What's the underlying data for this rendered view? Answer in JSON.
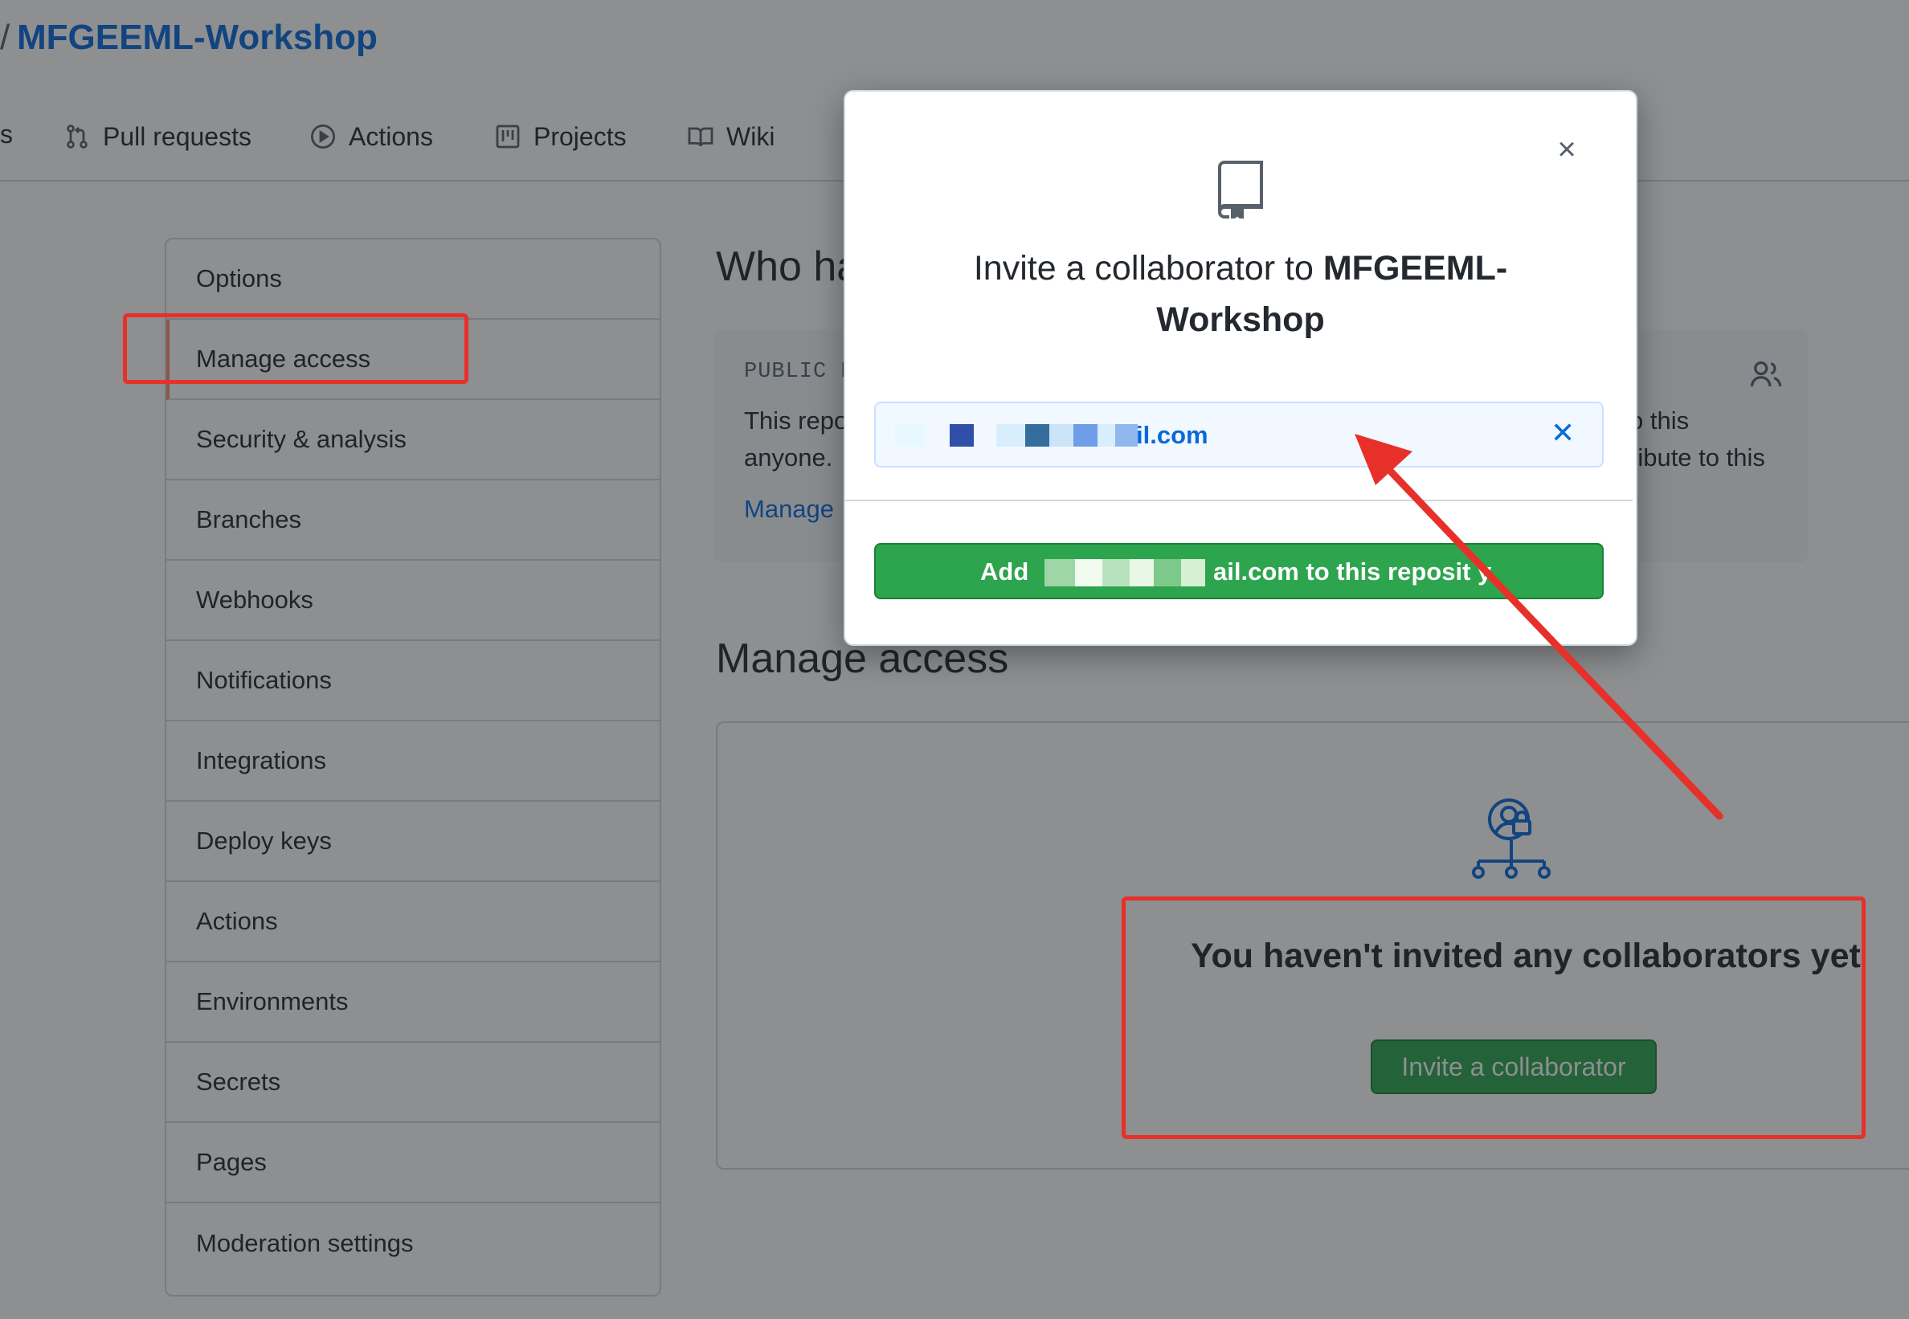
{
  "repo": {
    "slash": "/",
    "name": "MFGEEML-Workshop"
  },
  "tabs": [
    {
      "label": "s",
      "icon": "truncated"
    },
    {
      "label": "Pull requests",
      "icon": "pull-request-icon"
    },
    {
      "label": "Actions",
      "icon": "play-icon"
    },
    {
      "label": "Projects",
      "icon": "project-icon"
    },
    {
      "label": "Wiki",
      "icon": "book-icon"
    }
  ],
  "sidebar": {
    "items": [
      {
        "label": "Options"
      },
      {
        "label": "Manage access"
      },
      {
        "label": "Security & analysis"
      },
      {
        "label": "Branches"
      },
      {
        "label": "Webhooks"
      },
      {
        "label": "Notifications"
      },
      {
        "label": "Integrations"
      },
      {
        "label": "Deploy keys"
      },
      {
        "label": "Actions"
      },
      {
        "label": "Environments"
      },
      {
        "label": "Secrets"
      },
      {
        "label": "Pages"
      },
      {
        "label": "Moderation settings"
      }
    ]
  },
  "who": {
    "title": "Who ha",
    "public_label": "PUBLIC R",
    "text_line1": "This repo",
    "text_line2": "anyone.",
    "manage_link": "Manage",
    "right_line1": "o this",
    "right_line2": "ribute to this"
  },
  "manage_access": {
    "title": "Manage access",
    "empty_text": "You haven't invited any collaborators yet",
    "invite_button": "Invite a collaborator"
  },
  "modal": {
    "title_prefix": "Invite a collaborator to ",
    "title_repo_part1": "MFGEEML-",
    "title_repo_part2": "Workshop",
    "email_visible_suffix": "il.com",
    "add_prefix": "Add",
    "add_suffix": "ail.com to this reposit y"
  },
  "colors": {
    "accent_blue": "#0969da",
    "primary_green": "#2da44e",
    "highlight_red": "#e8302a"
  }
}
